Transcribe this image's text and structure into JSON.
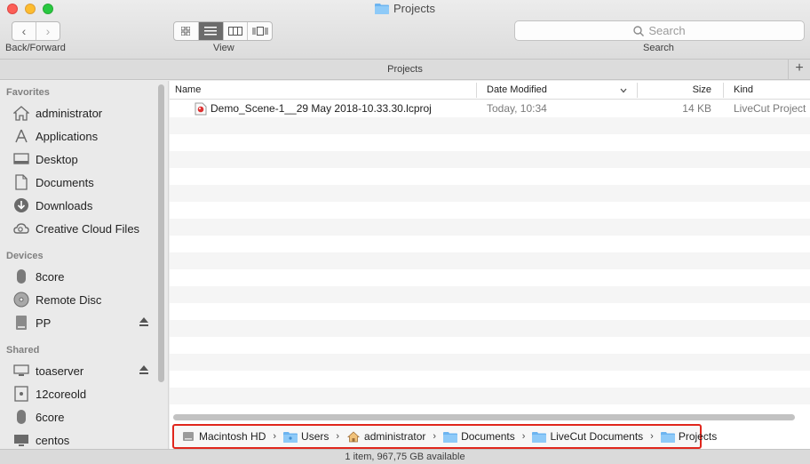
{
  "window": {
    "title": "Projects"
  },
  "toolbar": {
    "nav_label": "Back/Forward",
    "view_label": "View",
    "search_placeholder": "Search",
    "search_label": "Search"
  },
  "pathbar": {
    "title": "Projects"
  },
  "sidebar": {
    "favorites_header": "Favorites",
    "favorites": [
      "administrator",
      "Applications",
      "Desktop",
      "Documents",
      "Downloads",
      "Creative Cloud Files"
    ],
    "devices_header": "Devices",
    "devices": [
      "8core",
      "Remote Disc",
      "PP"
    ],
    "shared_header": "Shared",
    "shared": [
      "toaserver",
      "12coreold",
      "6core",
      "centos"
    ]
  },
  "columns": {
    "name": "Name",
    "date": "Date Modified",
    "size": "Size",
    "kind": "Kind"
  },
  "files": [
    {
      "name": "Demo_Scene-1__29 May 2018-10.33.30.lcproj",
      "date": "Today, 10:34",
      "size": "14 KB",
      "kind": "LiveCut Project"
    }
  ],
  "breadcrumb": [
    "Macintosh HD",
    "Users",
    "administrator",
    "Documents",
    "LiveCut Documents",
    "Projects"
  ],
  "status": {
    "text": "1 item, 967,75 GB available"
  },
  "colors": {
    "highlight": "#e0261c",
    "folder": "#6cb4f0"
  }
}
